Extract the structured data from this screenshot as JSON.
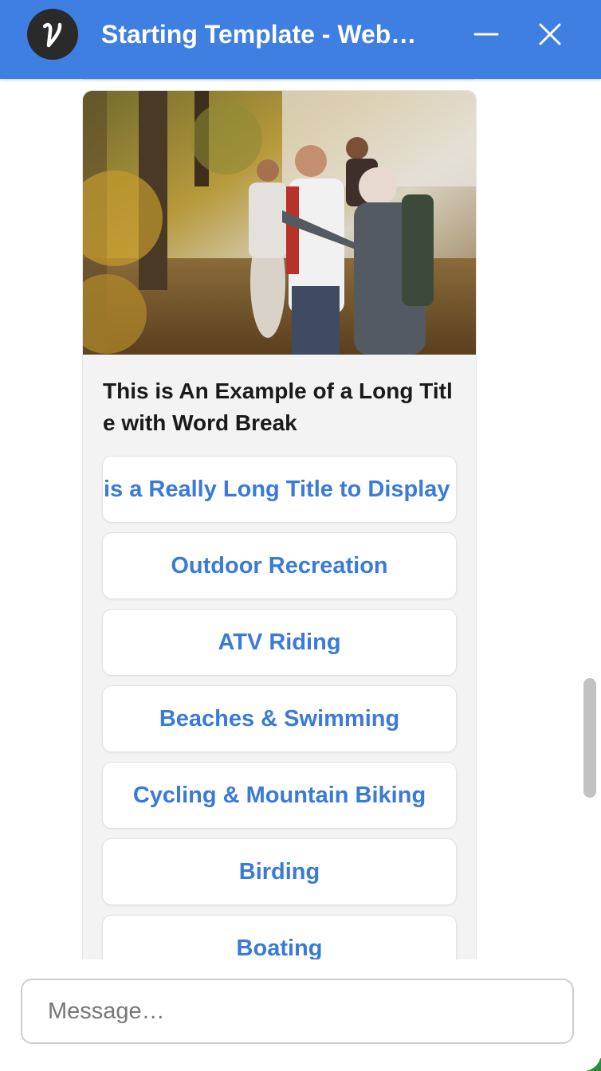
{
  "window": {
    "title": "Starting Template - Web…",
    "logo_letter": "v",
    "accent_color": "#3f7fe1"
  },
  "card": {
    "title": "This is An Example of a Long Title with Word Break",
    "options": [
      "This is a Really Long Title to Display Over",
      "Outdoor Recreation",
      "ATV Riding",
      "Beaches & Swimming",
      "Cycling & Mountain Biking",
      "Birding",
      "Boating"
    ]
  },
  "composer": {
    "placeholder": "Message…"
  },
  "icons": {
    "minimize": "minimize-icon",
    "close": "close-icon"
  }
}
